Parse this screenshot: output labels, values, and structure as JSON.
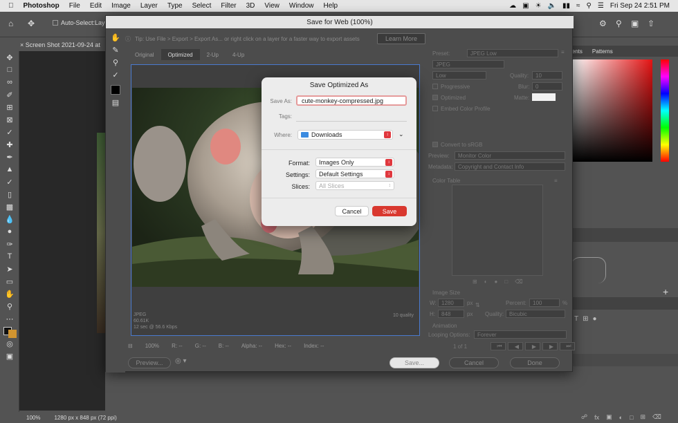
{
  "menubar": {
    "app": "Photoshop",
    "items": [
      "File",
      "Edit",
      "Image",
      "Layer",
      "Type",
      "Select",
      "Filter",
      "3D",
      "View",
      "Window",
      "Help"
    ],
    "clock": "Fri Sep 24  2:51 PM"
  },
  "options": {
    "auto_select": "Auto-Select:",
    "layer": "Laye"
  },
  "doc_tab": "Screen Shot 2021-09-24 at",
  "status": {
    "zoom": "100%",
    "dims": "1280 px x 848 px (72 ppi)"
  },
  "right_panel": {
    "tabs": [
      "ients",
      "Patterns"
    ]
  },
  "sfw": {
    "title": "Save for Web (100%)",
    "tip": "Tip: Use File > Export > Export As... or right click on a layer for a faster way to export assets",
    "learn_more": "Learn More",
    "tabs": [
      "Original",
      "Optimized",
      "2-Up",
      "4-Up"
    ],
    "preview_info": {
      "format": "JPEG",
      "size": "60.61K",
      "time": "12 sec @ 56.6 Kbps",
      "quality": "10 quality"
    },
    "bottom": {
      "zoom": "100%",
      "r": "R: --",
      "g": "G: --",
      "b": "B: --",
      "alpha": "Alpha: --",
      "hex": "Hex: --",
      "index": "Index: --"
    },
    "buttons": {
      "preview": "Preview...",
      "save": "Save...",
      "cancel": "Cancel",
      "done": "Done"
    },
    "settings": {
      "preset_label": "Preset:",
      "preset_value": "JPEG Low",
      "format": "JPEG",
      "quality_level": "Low",
      "quality_label": "Quality:",
      "quality_value": "10",
      "progressive": "Progressive",
      "blur_label": "Blur:",
      "blur_value": "0",
      "optimized": "Optimized",
      "matte_label": "Matte:",
      "embed": "Embed Color Profile",
      "convert": "Convert to sRGB",
      "preview_label": "Preview:",
      "preview_value": "Monitor Color",
      "metadata_label": "Metadata:",
      "metadata_value": "Copyright and Contact Info",
      "color_table": "Color Table",
      "image_size": "Image Size",
      "w_label": "W:",
      "w_value": "1280",
      "h_label": "H:",
      "h_value": "848",
      "px": "px",
      "percent_label": "Percent:",
      "percent_value": "100",
      "pct": "%",
      "quality2_label": "Quality:",
      "quality2_value": "Bicubic",
      "animation": "Animation",
      "looping_label": "Looping Options:",
      "looping_value": "Forever",
      "frame": "1 of 1"
    }
  },
  "dialog": {
    "title": "Save Optimized As",
    "save_as_label": "Save As:",
    "filename": "cute-monkey-compressed.jpg",
    "tags_label": "Tags:",
    "where_label": "Where:",
    "where_value": "Downloads",
    "format_label": "Format:",
    "format_value": "Images Only",
    "settings_label": "Settings:",
    "settings_value": "Default Settings",
    "slices_label": "Slices:",
    "slices_value": "All Slices",
    "cancel": "Cancel",
    "save": "Save"
  },
  "colors": {
    "accent_red": "#d9382f",
    "focus_blue": "#4a7bd0"
  }
}
